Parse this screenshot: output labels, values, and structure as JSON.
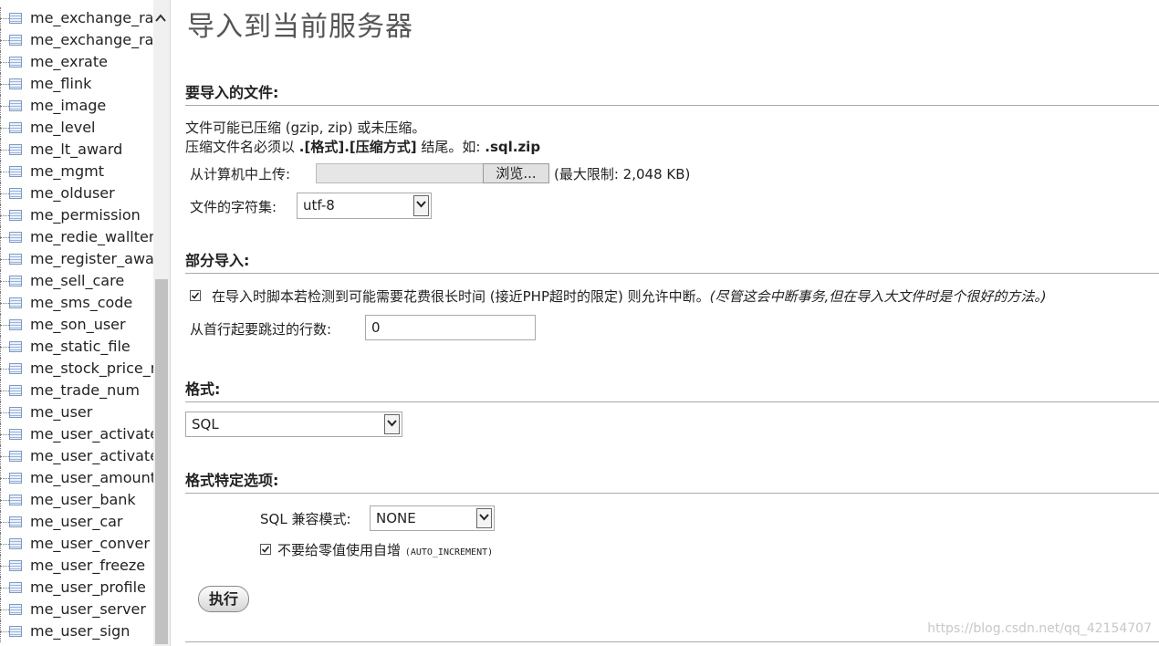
{
  "sidebar": {
    "tables": [
      "me_exchange_rate",
      "me_exchange_rate",
      "me_exrate",
      "me_flink",
      "me_image",
      "me_level",
      "me_lt_award",
      "me_mgmt",
      "me_olduser",
      "me_permission",
      "me_redie_wallter",
      "me_register_award",
      "me_sell_care",
      "me_sms_code",
      "me_son_user",
      "me_static_file",
      "me_stock_price_re",
      "me_trade_num",
      "me_user",
      "me_user_activate_",
      "me_user_activate_",
      "me_user_amount_",
      "me_user_bank",
      "me_user_car",
      "me_user_conver",
      "me_user_freeze",
      "me_user_profile",
      "me_user_server",
      "me_user_sign"
    ],
    "scroll_up_glyph": "^"
  },
  "main": {
    "title": "导入到当前服务器",
    "file_section": {
      "heading": "要导入的文件:",
      "line1": "文件可能已压缩 (gzip, zip) 或未压缩。",
      "line2_prefix": "压缩文件名必须以",
      "line2_bold": ".[格式].[压缩方式]",
      "line2_mid": "结尾。如:",
      "line2_example": ".sql.zip",
      "upload_label": "从计算机中上传:",
      "browse_label": "浏览...",
      "max_limit": "(最大限制: 2,048 KB)",
      "charset_label": "文件的字符集:",
      "charset_value": "utf-8"
    },
    "partial_section": {
      "heading": "部分导入:",
      "interrupt_label": "在导入时脚本若检测到可能需要花费很长时间 (接近PHP超时的限定) 则允许中断。",
      "interrupt_note": "(尽管这会中断事务,但在导入大文件时是个很好的方法。)",
      "interrupt_checked": true,
      "skip_label": "从首行起要跳过的行数:",
      "skip_value": "0"
    },
    "format_section": {
      "heading": "格式:",
      "format_value": "SQL"
    },
    "format_options": {
      "heading": "格式特定选项:",
      "compat_label": "SQL 兼容模式:",
      "compat_value": "NONE",
      "no_zero_label": "不要给零值使用自增",
      "no_zero_code": "(AUTO_INCREMENT)",
      "no_zero_checked": true
    },
    "go_button": "执行"
  },
  "watermark": "https://blog.csdn.net/qq_42154707"
}
